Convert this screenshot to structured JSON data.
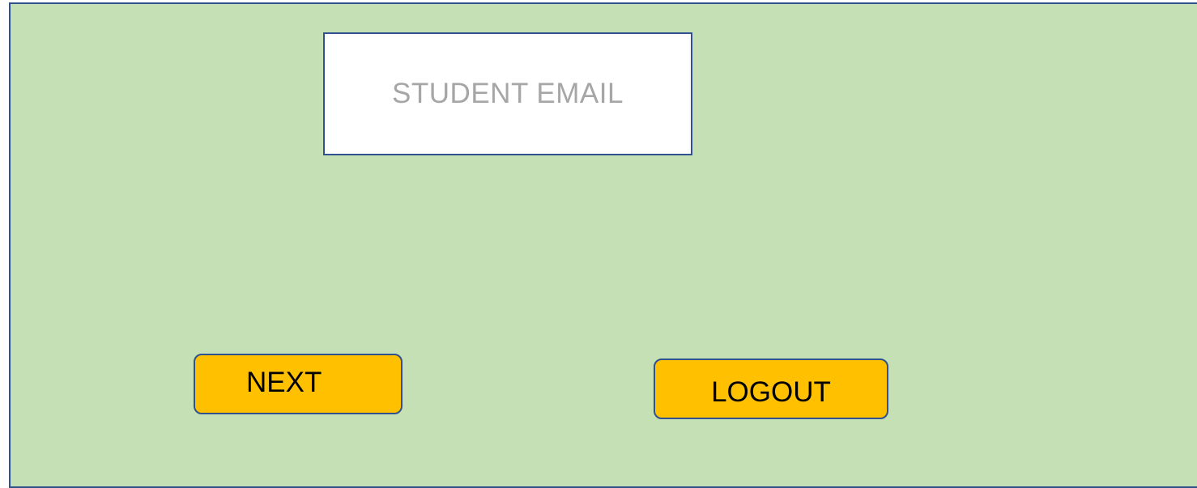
{
  "form": {
    "email_placeholder": "STUDENT EMAIL"
  },
  "buttons": {
    "next_label": "NEXT",
    "logout_label": "LOGOUT"
  },
  "colors": {
    "background": "#c5e0b4",
    "border": "#2f528f",
    "button": "#ffc000",
    "field": "#ffffff",
    "placeholder_text": "#a6a6a6"
  }
}
